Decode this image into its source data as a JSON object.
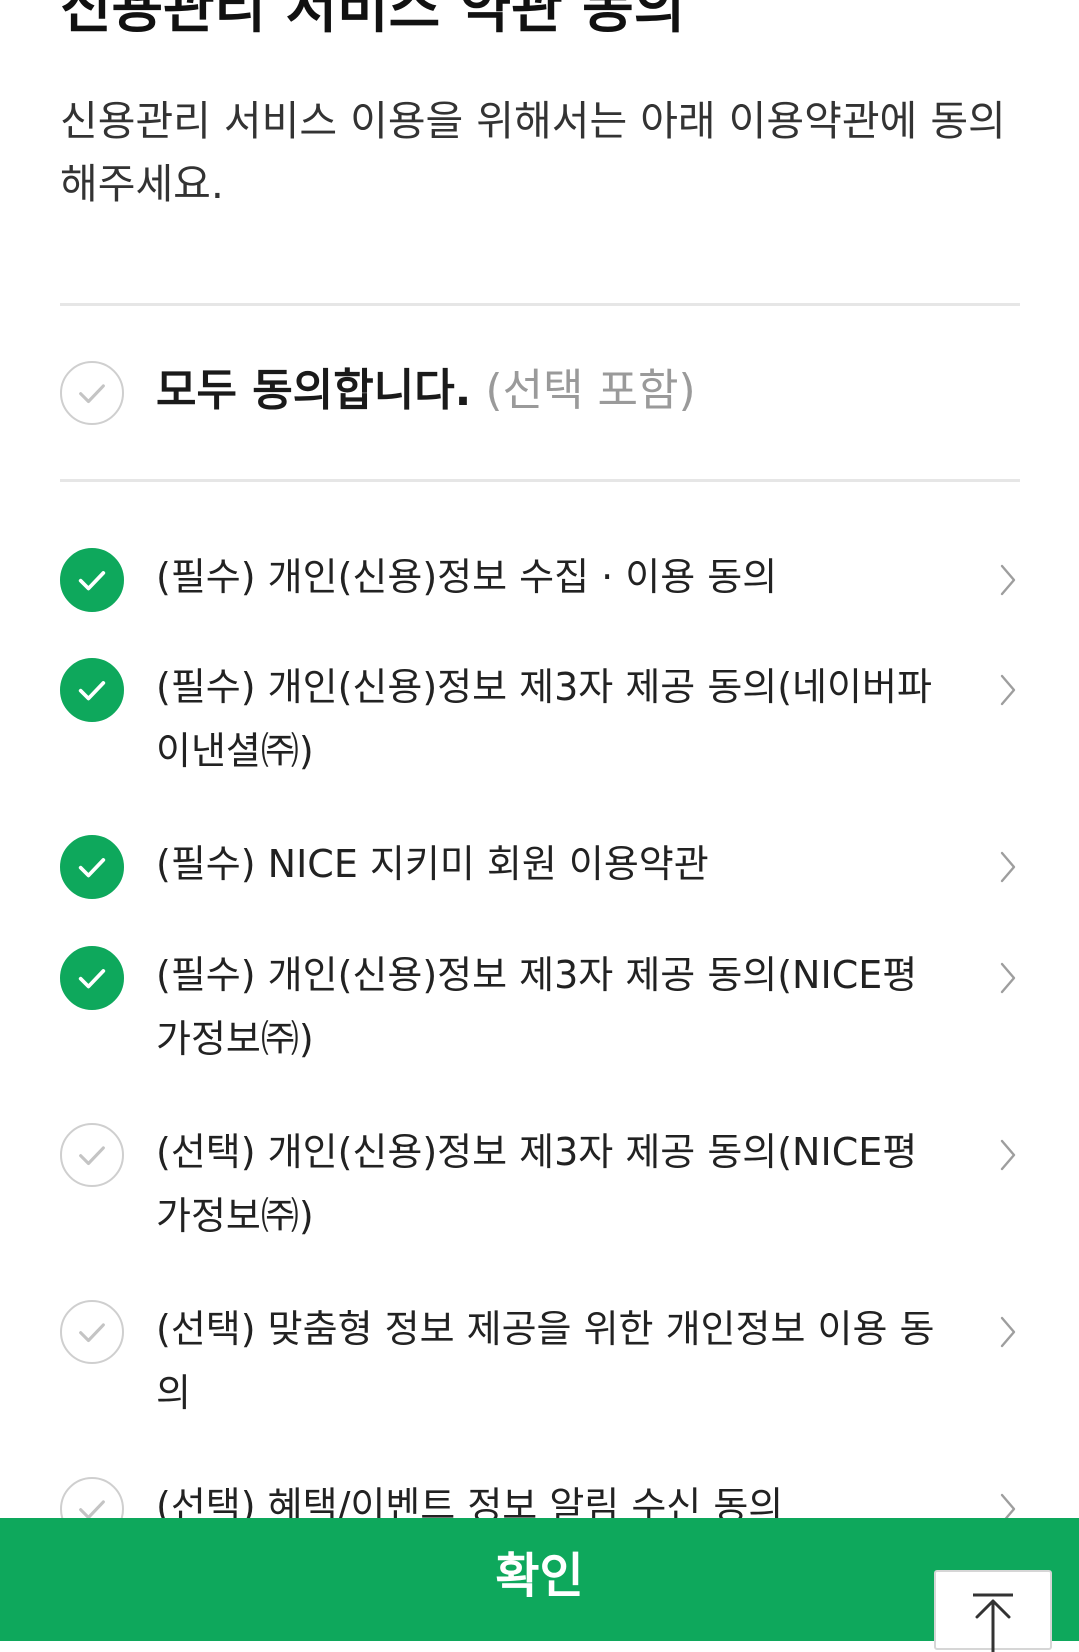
{
  "header": {
    "title": "신용관리 서비스 약관 동의",
    "description": "신용관리 서비스 이용을 위해서는 아래 이용약관에 동의해주세요."
  },
  "agree_all": {
    "label": "모두 동의합니다.",
    "sub_label": "(선택 포함)",
    "checked": false
  },
  "terms": [
    {
      "label": "(필수) 개인(신용)정보 수집 · 이용 동의",
      "checked": true
    },
    {
      "label": "(필수) 개인(신용)정보 제3자 제공 동의(네이버파이낸셜㈜)",
      "checked": true
    },
    {
      "label": "(필수) NICE 지키미 회원 이용약관",
      "checked": true
    },
    {
      "label": "(필수) 개인(신용)정보 제3자 제공 동의(NICE평가정보㈜)",
      "checked": true
    },
    {
      "label": "(선택) 개인(신용)정보 제3자 제공 동의(NICE평가정보㈜)",
      "checked": false
    },
    {
      "label": "(선택) 맞춤형 정보 제공을 위한 개인정보 이용 동의",
      "checked": false
    },
    {
      "label": "(선택) 혜택/이벤트 정보 알림 수신 동의",
      "checked": false
    }
  ],
  "footer": {
    "confirm_label": "확인"
  },
  "icons": {
    "check": "check-icon",
    "chevron": "chevron-right-icon",
    "scroll_top": "arrow-up-icon"
  },
  "colors": {
    "accent": "#0ea85c",
    "unchecked_border": "#cfcfcf",
    "sub_label": "#9a9a9a"
  }
}
